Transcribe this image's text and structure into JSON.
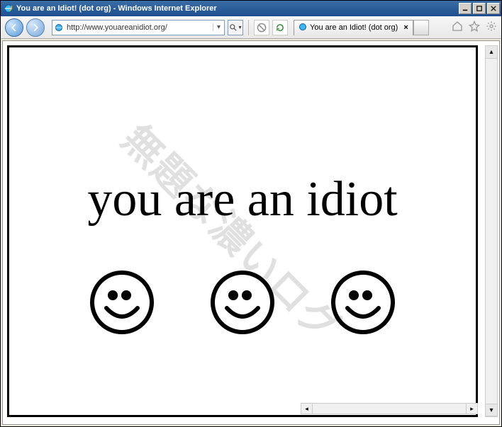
{
  "window": {
    "title": "You are an Idiot! (dot org) - Windows Internet Explorer"
  },
  "toolbar": {
    "url": "http://www.youareanidiot.org/",
    "url_prefix": "http://www.",
    "url_domain": "youareanidiot.org",
    "url_suffix": "/"
  },
  "tab": {
    "title": "You are an Idiot! (dot org)"
  },
  "page": {
    "main_text": "you are an idiot",
    "watermark": "無題な濃いログ"
  },
  "icons": {
    "smiley": "smiley"
  }
}
